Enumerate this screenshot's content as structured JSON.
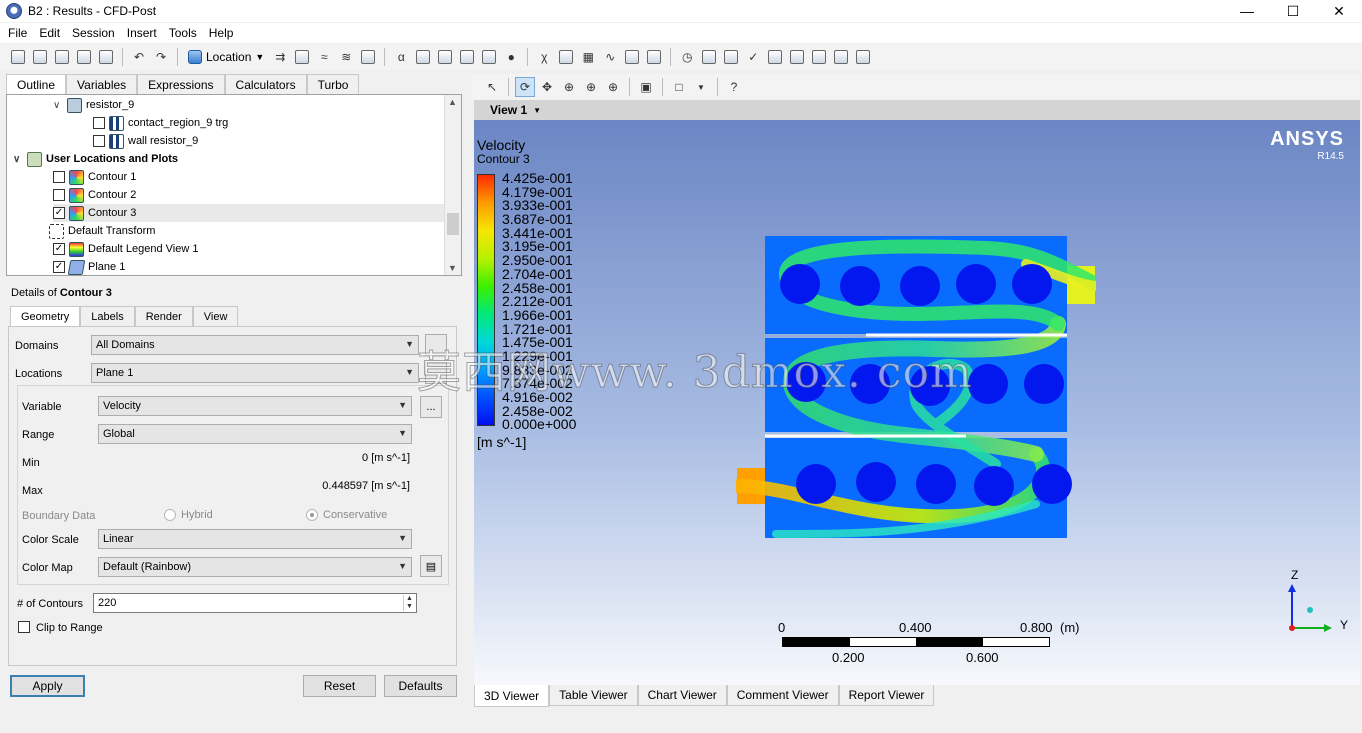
{
  "window": {
    "title": "B2 : Results - CFD-Post"
  },
  "menu": [
    "File",
    "Edit",
    "Session",
    "Insert",
    "Tools",
    "Help"
  ],
  "toolbar": {
    "location_label": "Location"
  },
  "left_tabs": [
    "Outline",
    "Variables",
    "Expressions",
    "Calculators",
    "Turbo"
  ],
  "tree": [
    {
      "label": "resistor_9",
      "icon": "object-icon",
      "checkbox": null,
      "expand": "expanded"
    },
    {
      "label": "contact_region_9 trg",
      "icon": "wall-icon",
      "checkbox": false
    },
    {
      "label": "wall resistor_9",
      "icon": "wall-icon",
      "checkbox": false
    },
    {
      "label": "User Locations and Plots",
      "icon": "folder-icon",
      "checkbox": null,
      "expand": "expanded"
    },
    {
      "label": "Contour 1",
      "icon": "contour-icon",
      "checkbox": false
    },
    {
      "label": "Contour 2",
      "icon": "contour-icon",
      "checkbox": false
    },
    {
      "label": "Contour 3",
      "icon": "contour-icon",
      "checkbox": true
    },
    {
      "label": "Default Transform",
      "icon": "transform-icon",
      "checkbox": null
    },
    {
      "label": "Default Legend View 1",
      "icon": "legend-icon",
      "checkbox": true
    },
    {
      "label": "Plane 1",
      "icon": "plane-icon",
      "checkbox": true
    }
  ],
  "details": {
    "prefix": "Details of ",
    "object": "Contour 3",
    "tabs": [
      "Geometry",
      "Labels",
      "Render",
      "View"
    ],
    "domains_label": "Domains",
    "domains_value": "All Domains",
    "locations_label": "Locations",
    "locations_value": "Plane 1",
    "variable_label": "Variable",
    "variable_value": "Velocity",
    "variable_button": "...",
    "range_label": "Range",
    "range_value": "Global",
    "min_label": "Min",
    "min_value": "0 [m s^-1]",
    "max_label": "Max",
    "max_value": "0.448597 [m s^-1]",
    "boundary_label": "Boundary Data",
    "boundary_hybrid": "Hybrid",
    "boundary_conservative": "Conservative",
    "color_scale_label": "Color Scale",
    "color_scale_value": "Linear",
    "color_map_label": "Color Map",
    "color_map_value": "Default (Rainbow)",
    "contours_label": "# of Contours",
    "contours_value": "220",
    "clip_label": "Clip to Range",
    "apply": "Apply",
    "reset": "Reset",
    "defaults": "Defaults"
  },
  "viewer": {
    "view_name": "View 1",
    "brand": "ANSYS",
    "version": "R14.5",
    "legend_title": "Velocity",
    "legend_sub": "Contour 3",
    "legend_values": [
      "4.425e-001",
      "4.179e-001",
      "3.933e-001",
      "3.687e-001",
      "3.441e-001",
      "3.195e-001",
      "2.950e-001",
      "2.704e-001",
      "2.458e-001",
      "2.212e-001",
      "1.966e-001",
      "1.721e-001",
      "1.475e-001",
      "1.229e-001",
      "9.833e-002",
      "7.374e-002",
      "4.916e-002",
      "2.458e-002",
      "0.000e+000"
    ],
    "legend_unit": "[m s^-1]",
    "scale_top": [
      "0",
      "0.400",
      "0.800",
      "(m)"
    ],
    "scale_bottom": [
      "0.200",
      "0.600"
    ],
    "axis_z": "Z",
    "axis_y": "Y",
    "watermark": "莫西网www. 3dmox. com",
    "tabs": [
      "3D Viewer",
      "Table Viewer",
      "Chart Viewer",
      "Comment Viewer",
      "Report Viewer"
    ]
  }
}
